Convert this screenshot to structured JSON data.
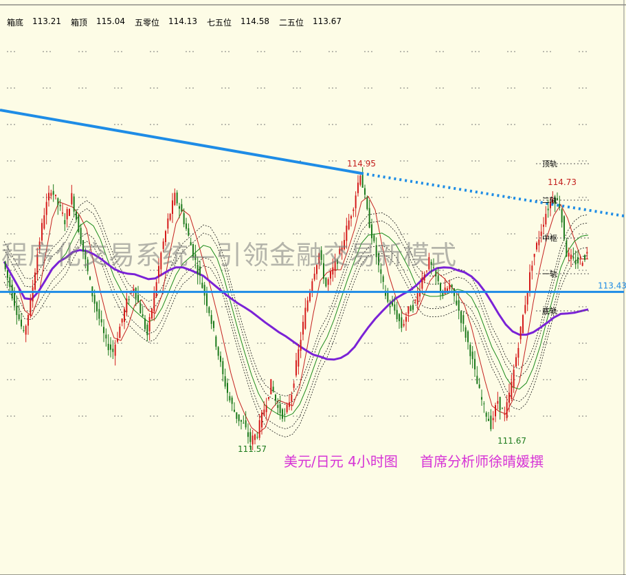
{
  "info": {
    "box_bottom_label": "箱底",
    "box_bottom_value": "113.21",
    "box_top_label": "箱顶",
    "box_top_value": "115.04",
    "level_500_label": "五零位",
    "level_500_value": "114.13",
    "level_750_label": "七五位",
    "level_750_value": "114.58",
    "level_250_label": "二五位",
    "level_250_value": "113.67"
  },
  "watermark": "程序化交易系统—引领金融交易新模式",
  "caption": {
    "title": "美元/日元 4小时图",
    "author": "首席分析师徐晴媛撰"
  },
  "chart_data": {
    "type": "candlestick",
    "instrument": "美元/日元",
    "timeframe": "4小时图",
    "price_range": [
      111.1,
      115.7
    ],
    "annotations": [
      {
        "text": "114.95",
        "value": 114.95
      },
      {
        "text": "111.57",
        "value": 111.57
      },
      {
        "text": "111.67",
        "value": 111.67
      },
      {
        "text": "114.73",
        "value": 114.73
      }
    ],
    "support_line": {
      "label": "113.43",
      "value": 113.43
    },
    "channel_labels": [
      "顶轨",
      "二轨",
      "中枢",
      "一轨",
      "底轨"
    ],
    "price_path": [
      113.8,
      113.5,
      113.2,
      112.9,
      113.3,
      113.9,
      114.4,
      114.7,
      114.5,
      114.3,
      114.6,
      114.2,
      113.8,
      113.4,
      113.1,
      112.8,
      112.7,
      113.0,
      113.3,
      113.5,
      113.2,
      112.9,
      113.4,
      113.9,
      114.3,
      114.6,
      114.4,
      114.1,
      113.8,
      113.5,
      113.2,
      112.8,
      112.4,
      112.1,
      111.9,
      111.8,
      111.6,
      111.7,
      112.0,
      112.3,
      112.0,
      111.9,
      112.2,
      112.7,
      113.2,
      113.6,
      113.9,
      113.5,
      113.7,
      113.9,
      114.2,
      114.5,
      114.9,
      114.4,
      114.0,
      113.6,
      113.3,
      113.2,
      113.0,
      113.2,
      113.3,
      113.6,
      113.8,
      113.6,
      113.4,
      113.5,
      113.3,
      113.0,
      112.7,
      112.3,
      112.0,
      111.8,
      112.1,
      111.9,
      112.3,
      112.8,
      113.3,
      113.8,
      114.1,
      114.4,
      114.6,
      114.5,
      113.9,
      113.8,
      113.8,
      113.9
    ]
  }
}
